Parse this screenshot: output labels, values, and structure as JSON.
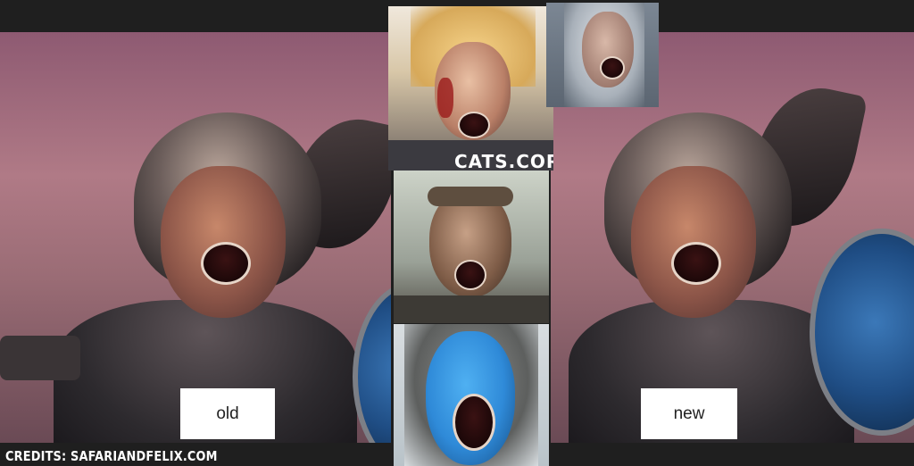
{
  "labels": {
    "old": "old",
    "new": "new"
  },
  "credits": "CREDITS: SAFARIANDFELIX.COM",
  "watermark": "CATS.CORN",
  "colors": {
    "background": "#1f1f1f",
    "sky": "#b07a86",
    "blue_face": "#2f8ad8",
    "shield_blue": "#1f4d84"
  },
  "images": [
    "old-valkyrie-artwork",
    "new-valkyrie-artwork",
    "blonde-warrior-screaming",
    "silver-haired-warrior-screaming",
    "muddy-warrior-screaming",
    "blue-painted-warrior-screaming"
  ]
}
